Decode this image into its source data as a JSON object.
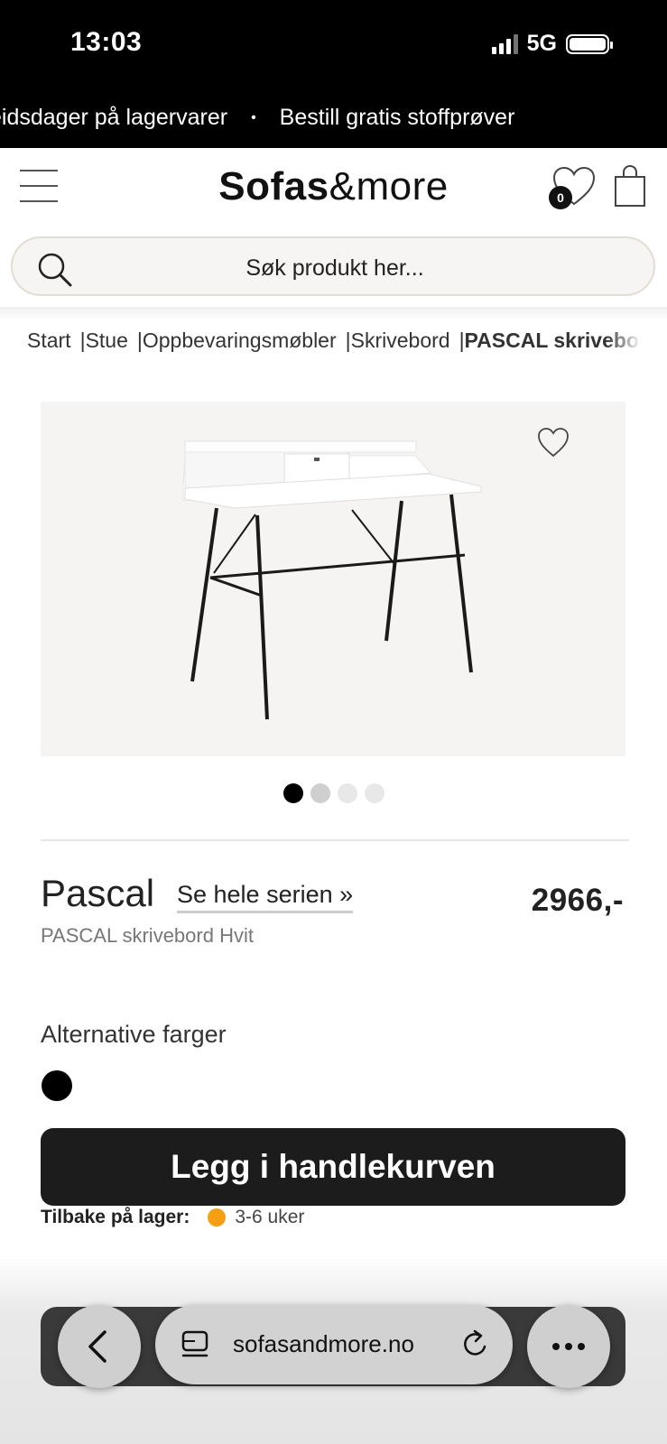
{
  "status": {
    "time": "13:03",
    "network": "5G",
    "battery_level": 1.0
  },
  "ticker": {
    "left_text": "eidsdager på lagervarer",
    "separator": "•",
    "right_text": "Bestill gratis stoffprøver"
  },
  "header": {
    "logo_bold": "Sofas",
    "logo_rest": "&more",
    "wishlist_count": "0"
  },
  "search": {
    "placeholder": "Søk produkt her..."
  },
  "breadcrumb": {
    "items": [
      "Start",
      "Stue",
      "Oppbevaringsmøbler",
      "Skrivebord"
    ],
    "separator": "|",
    "current": "PASCAL skrivebord Hvit"
  },
  "gallery": {
    "image_count": 4,
    "active_index": 0
  },
  "product": {
    "name": "Pascal",
    "series_link": "Se hele serien »",
    "price": "2966,-",
    "subtitle": "PASCAL skrivebord Hvit"
  },
  "colors": {
    "title": "Alternative farger",
    "swatches": [
      "#000000"
    ]
  },
  "cta": {
    "label": "Legg i handlekurven"
  },
  "stock": {
    "label": "Tilbake på lager:",
    "value": "3-6 uker",
    "status_color": "#f4a012"
  },
  "browser": {
    "url": "sofasandmore.no"
  }
}
